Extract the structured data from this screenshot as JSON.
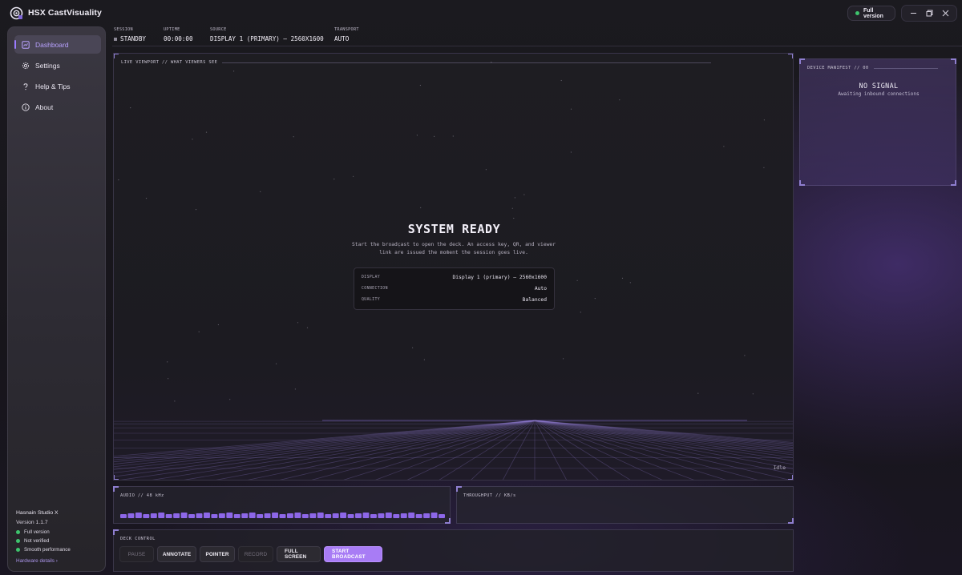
{
  "app": {
    "title": "HSX CastVisuality",
    "version_pill": "Full version"
  },
  "window_controls": [
    "minimize",
    "restore",
    "close"
  ],
  "sidebar": {
    "items": [
      {
        "label": "Dashboard",
        "icon": "dashboard-icon",
        "active": true
      },
      {
        "label": "Settings",
        "icon": "gear-icon",
        "active": false
      },
      {
        "label": "Help & Tips",
        "icon": "question-icon",
        "active": false
      },
      {
        "label": "About",
        "icon": "info-icon",
        "active": false
      }
    ],
    "footer": {
      "brand": "Hasnain Studio X",
      "version": "Version 1.1.7",
      "statuses": [
        {
          "label": "Full version",
          "color": "#3ec46d"
        },
        {
          "label": "Not verified",
          "color": "#3ec46d"
        },
        {
          "label": "Smooth performance",
          "color": "#3ec46d"
        }
      ],
      "hardware_link": "Hardware details ›"
    }
  },
  "meta": {
    "session": {
      "label": "SESSION",
      "value": "STANDBY"
    },
    "uptime": {
      "label": "UPTIME",
      "value": "00:00:00"
    },
    "source": {
      "label": "SOURCE",
      "value": "DISPLAY 1 (PRIMARY) — 2560X1600"
    },
    "transport": {
      "label": "TRANSPORT",
      "value": "AUTO"
    }
  },
  "viewport": {
    "label": "LIVE VIEWPORT  //  WHAT VIEWERS SEE",
    "title": "SYSTEM READY",
    "description": "Start the broadcast to open the deck. An access key, QR, and viewer link are issued the moment the session goes live.",
    "info": [
      {
        "key": "DISPLAY",
        "value": "Display 1 (primary) — 2560x1600"
      },
      {
        "key": "CONNECTION",
        "value": "Auto"
      },
      {
        "key": "QUALITY",
        "value": "Balanced"
      }
    ],
    "status": "Idle"
  },
  "manifest": {
    "label": "DEVICE MANIFEST  //  00",
    "title": "NO SIGNAL",
    "subtitle": "Awaiting inbound connections"
  },
  "audio": {
    "label": "AUDIO  //  48 kHz"
  },
  "throughput": {
    "label": "THROUGHPUT  //  KB/s"
  },
  "deck": {
    "label": "DECK CONTROL",
    "buttons": [
      {
        "label": "PAUSE",
        "state": "disabled"
      },
      {
        "label": "ANNOTATE",
        "state": "normal"
      },
      {
        "label": "POINTER",
        "state": "normal"
      },
      {
        "label": "RECORD",
        "state": "disabled"
      },
      {
        "label": "FULL SCREEN",
        "state": "normal"
      },
      {
        "label": "START BROADCAST",
        "state": "primary"
      }
    ]
  },
  "colors": {
    "accent": "#a87cf5",
    "accent_text": "#b9a2ff",
    "ok": "#3ec46d",
    "background": "#161419"
  }
}
